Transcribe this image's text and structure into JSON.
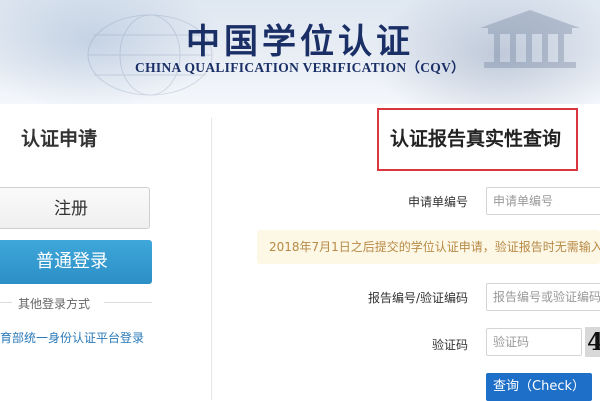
{
  "header": {
    "title_cn": "中国学位认证",
    "title_en": "CHINA QUALIFICATION VERIFICATION（CQV）"
  },
  "left_panel": {
    "title": "认证申请",
    "register_label": "注册",
    "login_label": "普通登录",
    "other_login_label": "其他登录方式",
    "unified_login_link": "育部统一身份认证平台登录"
  },
  "right_panel": {
    "title": "认证报告真实性查询",
    "application_no": {
      "label": "申请单编号",
      "placeholder": "申请单编号"
    },
    "notice": "2018年7月1日之后提交的学位认证申请，验证报告时无需输入",
    "report_no": {
      "label": "报告编号/验证编码",
      "placeholder": "报告编号或验证编码"
    },
    "captcha": {
      "label": "验证码",
      "placeholder": "验证码",
      "image_glyph": "4"
    },
    "query_button": "查询（Check）"
  },
  "colors": {
    "title_blue": "#1a2f66",
    "login_button": "#2c8fc5",
    "query_button": "#1d6fc7",
    "highlight_border": "#d9363e",
    "notice_bg": "#fdf7e6",
    "notice_text": "#b78a45",
    "link": "#2a79b8"
  }
}
